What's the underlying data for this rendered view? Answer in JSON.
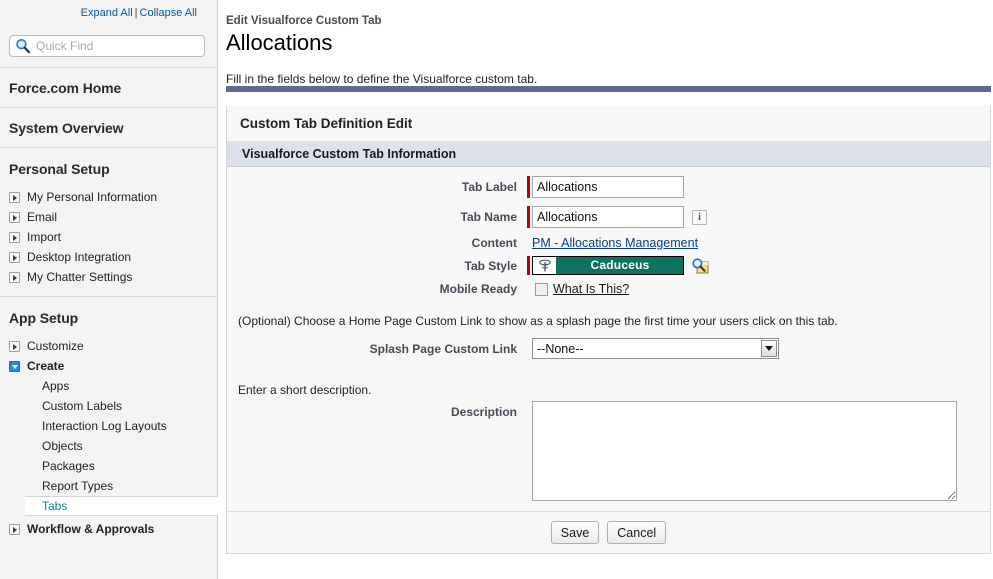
{
  "sidebar": {
    "expand_all": "Expand All",
    "separator": "|",
    "collapse_all": "Collapse All",
    "quick_find_placeholder": "Quick Find",
    "quick_find_value": "",
    "force_home": "Force.com Home",
    "system_overview": "System Overview",
    "personal_setup_header": "Personal Setup",
    "personal_setup_items": [
      {
        "label": "My Personal Information"
      },
      {
        "label": "Email"
      },
      {
        "label": "Import"
      },
      {
        "label": "Desktop Integration"
      },
      {
        "label": "My Chatter Settings"
      }
    ],
    "app_setup_header": "App Setup",
    "customize": "Customize",
    "create": "Create",
    "create_children": [
      {
        "label": "Apps"
      },
      {
        "label": "Custom Labels"
      },
      {
        "label": "Interaction Log Layouts"
      },
      {
        "label": "Objects"
      },
      {
        "label": "Packages"
      },
      {
        "label": "Report Types"
      }
    ],
    "selected_child": "Tabs",
    "workflow": "Workflow & Approvals"
  },
  "header": {
    "eyebrow": "Edit Visualforce Custom Tab",
    "title": "Allocations",
    "intro": "Fill in the fields below to define the Visualforce custom tab."
  },
  "panel": {
    "title": "Custom Tab Definition Edit",
    "section_title": "Visualforce Custom Tab Information",
    "fields": {
      "tab_label": {
        "label": "Tab Label",
        "value": "Allocations",
        "required": true
      },
      "tab_name": {
        "label": "Tab Name",
        "value": "Allocations",
        "required": true,
        "info": "i"
      },
      "content": {
        "label": "Content",
        "value": "PM - Allocations Management"
      },
      "tab_style": {
        "label": "Tab Style",
        "value": "Caduceus",
        "required": true,
        "color": "#0d7260"
      },
      "mobile_ready": {
        "label": "Mobile Ready",
        "checked": false,
        "link": "What Is This?"
      }
    },
    "splash": {
      "help": "(Optional) Choose a Home Page Custom Link to show as a splash page the first time your users click on this tab.",
      "label": "Splash Page Custom Link",
      "value": "--None--",
      "options": [
        "--None--"
      ]
    },
    "description": {
      "help": "Enter a short description.",
      "label": "Description",
      "value": "",
      "placeholder": ""
    },
    "buttons": {
      "save": "Save",
      "cancel": "Cancel"
    }
  }
}
